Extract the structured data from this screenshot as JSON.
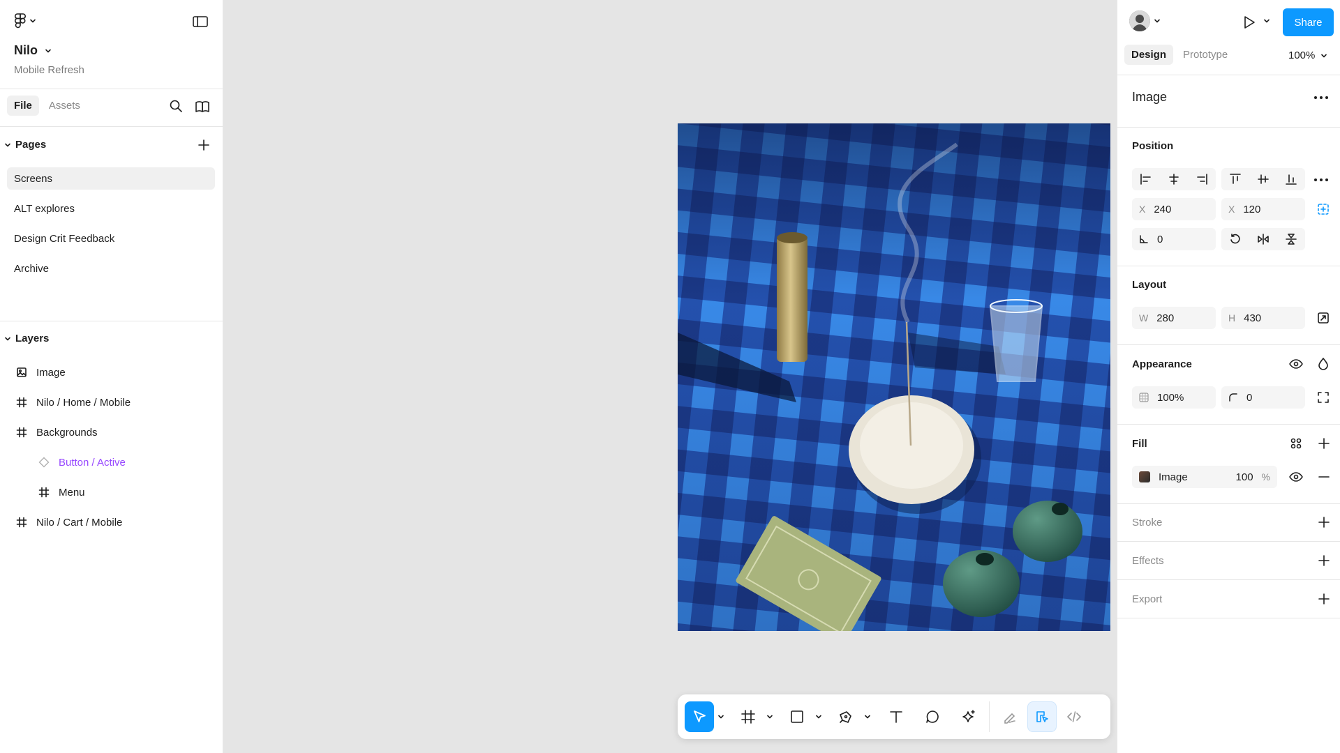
{
  "file": {
    "name": "Nilo",
    "project": "Mobile Refresh"
  },
  "left_tabs": [
    {
      "label": "File"
    },
    {
      "label": "Assets"
    }
  ],
  "pages": {
    "title": "Pages",
    "items": [
      {
        "label": "Screens"
      },
      {
        "label": "ALT explores"
      },
      {
        "label": "Design Crit Feedback"
      },
      {
        "label": "Archive"
      }
    ]
  },
  "layers": {
    "title": "Layers",
    "items": [
      {
        "label": "Image",
        "icon": "image-icon"
      },
      {
        "label": "Nilo / Home / Mobile",
        "icon": "frame-icon"
      },
      {
        "label": "Backgrounds",
        "icon": "frame-icon"
      },
      {
        "label": "Button / Active",
        "icon": "component-instance-icon"
      },
      {
        "label": "Menu",
        "icon": "frame-icon"
      },
      {
        "label": "Nilo / Cart / Mobile",
        "icon": "frame-icon"
      }
    ]
  },
  "right": {
    "share_label": "Share",
    "tabs": [
      {
        "label": "Design"
      },
      {
        "label": "Prototype"
      }
    ],
    "zoom": "100%",
    "selection_title": "Image",
    "position": {
      "title": "Position",
      "x_label": "X",
      "x_value": "240",
      "y_label": "X",
      "y_value": "120",
      "rotation_value": "0"
    },
    "layout": {
      "title": "Layout",
      "w_label": "W",
      "w_value": "280",
      "h_label": "H",
      "h_value": "430"
    },
    "appearance": {
      "title": "Appearance",
      "opacity": "100%",
      "radius": "0"
    },
    "fill": {
      "title": "Fill",
      "type": "Image",
      "opacity": "100",
      "unit": "%"
    },
    "stroke": {
      "title": "Stroke"
    },
    "effects": {
      "title": "Effects"
    },
    "export": {
      "title": "Export"
    }
  },
  "colors": {
    "accent": "#0d99ff",
    "component": "#9747ff"
  }
}
